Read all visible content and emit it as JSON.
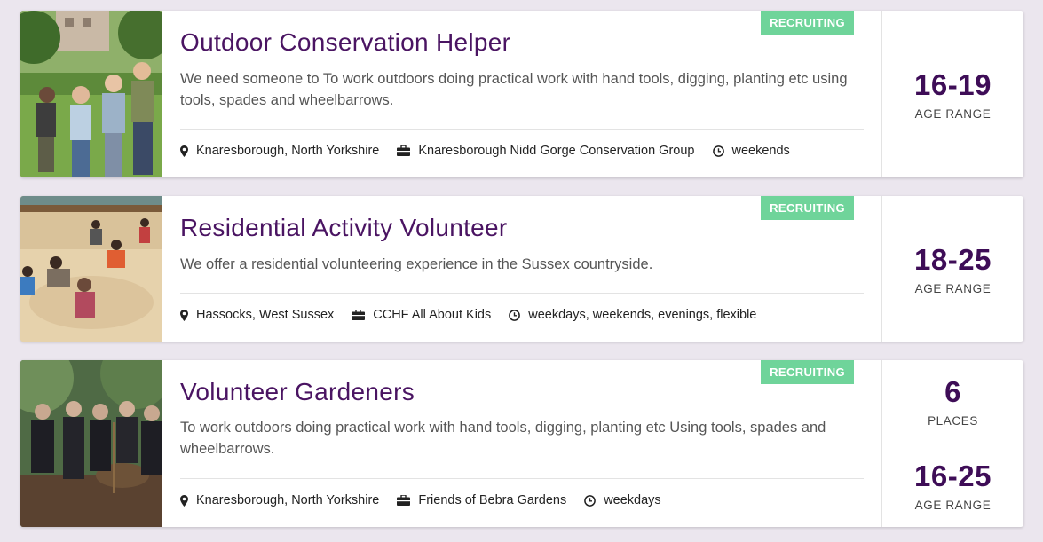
{
  "colors": {
    "accent": "#4a1462",
    "badge": "#6fd49a",
    "page_bg": "#ebe6ee"
  },
  "opportunities": [
    {
      "title": "Outdoor Conservation Helper",
      "badge": "RECRUITING",
      "description": "We need someone to To work outdoors doing practical work with hand tools, digging, planting etc using tools, spades and wheelbarrows.",
      "location_icon": "map-marker-icon",
      "location": "Knaresborough, North Yorkshire",
      "organisation_icon": "briefcase-icon",
      "organisation": "Knaresborough Nidd Gorge Conservation Group",
      "time_icon": "clock-icon",
      "availability": "weekends",
      "stats": [
        {
          "value": "16-19",
          "label": "AGE RANGE"
        }
      ]
    },
    {
      "title": "Residential Activity Volunteer",
      "badge": "RECRUITING",
      "description": "We offer a residential volunteering experience in the Sussex countryside.",
      "location_icon": "map-marker-icon",
      "location": "Hassocks, West Sussex",
      "organisation_icon": "briefcase-icon",
      "organisation": "CCHF All About Kids",
      "time_icon": "clock-icon",
      "availability": "weekdays, weekends, evenings, flexible",
      "stats": [
        {
          "value": "18-25",
          "label": "AGE RANGE"
        }
      ]
    },
    {
      "title": "Volunteer Gardeners",
      "badge": "RECRUITING",
      "description": "To work outdoors doing practical work with hand tools, digging, planting etc Using tools, spades and wheelbarrows.",
      "location_icon": "map-marker-icon",
      "location": "Knaresborough, North Yorkshire",
      "organisation_icon": "briefcase-icon",
      "organisation": "Friends of Bebra Gardens",
      "time_icon": "clock-icon",
      "availability": "weekdays",
      "stats": [
        {
          "value": "6",
          "label": "PLACES"
        },
        {
          "value": "16-25",
          "label": "AGE RANGE"
        }
      ]
    }
  ]
}
